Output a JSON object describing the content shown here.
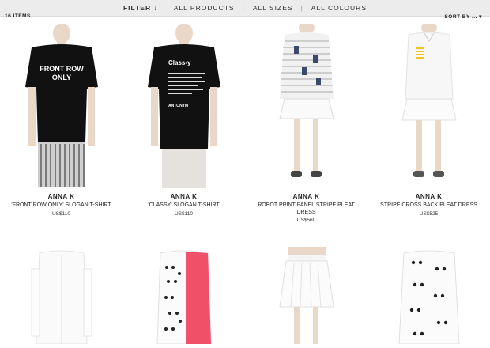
{
  "filter_bar": {
    "filter_label": "FILTER",
    "filter_arrow": "↓",
    "products": "ALL PRODUCTS",
    "sizes": "ALL SIZES",
    "colours": "ALL COLOURS",
    "separator": "|"
  },
  "results": {
    "count": "16 ITEMS",
    "sort_label": "SORT BY ... ▾"
  },
  "products": [
    {
      "brand": "ANNA K",
      "name": "'FRONT ROW ONLY' SLOGAN T-SHIRT",
      "price": "US$110",
      "print": [
        "FRONT ROW",
        "ONLY"
      ]
    },
    {
      "brand": "ANNA K",
      "name": "'CLASSY' SLOGAN T-SHIRT",
      "price": "US$110",
      "print": [
        "Class-y",
        "ANTONYM"
      ]
    },
    {
      "brand": "ANNA K",
      "name": "ROBOT PRINT PANEL STRIPE PLEAT DRESS",
      "price": "US$560"
    },
    {
      "brand": "ANNA K",
      "name": "STRIPE CROSS BACK PLEAT DRESS",
      "price": "US$525"
    },
    {},
    {},
    {},
    {}
  ]
}
